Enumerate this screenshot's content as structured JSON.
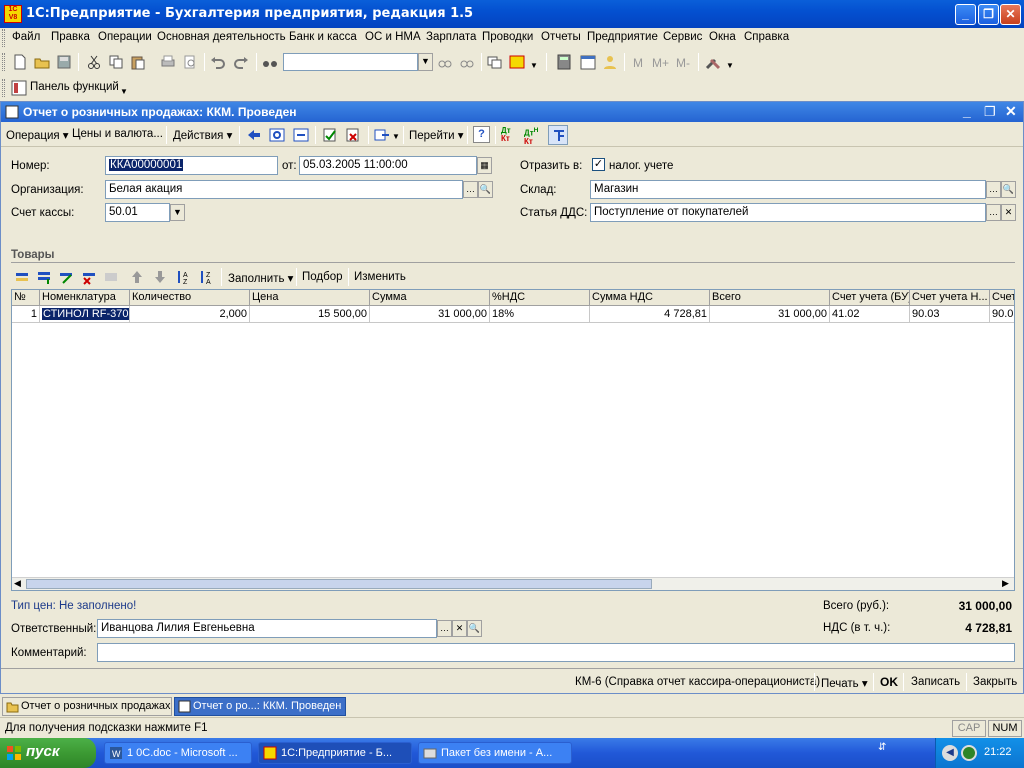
{
  "app": {
    "title": "1С:Предприятие - Бухгалтерия предприятия, редакция 1.5",
    "icon_text": "1C\nV8"
  },
  "menu": [
    "Файл",
    "Правка",
    "Операции",
    "Основная деятельность",
    "Банк и касса",
    "ОС и НМА",
    "Зарплата",
    "Проводки",
    "Отчеты",
    "Предприятие",
    "Сервис",
    "Окна",
    "Справка"
  ],
  "toolbar2": {
    "panel_label": "Панель функций",
    "mark_m": "M",
    "mark_mplus": "M+",
    "mark_mminus": "M-"
  },
  "doc": {
    "title": "Отчет о розничных продажах: ККМ. Проведен",
    "toolbar": {
      "operation": "Операция",
      "prices": "Цены и валюта...",
      "actions": "Действия",
      "goto": "Перейти",
      "help": "?"
    },
    "fields": {
      "number_label": "Номер:",
      "number_value": "ККА00000001",
      "from_label": "от:",
      "from_value": "05.03.2005 11:00:00",
      "org_label": "Организация:",
      "org_value": "Белая акация",
      "cash_label": "Счет кассы:",
      "cash_value": "50.01",
      "reflect_label": "Отразить в:",
      "reflect_check": "налог. учете",
      "warehouse_label": "Склад:",
      "warehouse_value": "Магазин",
      "dds_label": "Статья ДДС:",
      "dds_value": "Поступление от покупателей"
    },
    "goods": {
      "section_label": "Товары",
      "fill_label": "Заполнить",
      "pick_label": "Подбор",
      "change_label": "Изменить",
      "columns": [
        "№",
        "Номенклатура",
        "Количество",
        "Цена",
        "Сумма",
        "%НДС",
        "Сумма НДС",
        "Всего",
        "Счет учета (БУ)",
        "Счет учета Н...",
        "Счет"
      ],
      "rows": [
        [
          "1",
          "СТИНОЛ RF-370",
          "2,000",
          "15 500,00",
          "31 000,00",
          "18%",
          "4 728,81",
          "31 000,00",
          "41.02",
          "90.03",
          "90.0"
        ]
      ]
    },
    "price_type": "Тип цен: Не заполнено!",
    "total_label": "Всего (руб.):",
    "total_value": "31 000,00",
    "vat_label": "НДС (в т. ч.):",
    "vat_value": "4 728,81",
    "responsible_label": "Ответственный:",
    "responsible_value": "Иванцова Лилия Евгеньевна",
    "comment_label": "Комментарий:",
    "comment_value": "",
    "footer": {
      "km6": "КМ-6 (Справка отчет кассира-операциониста)",
      "print": "Печать",
      "ok": "OK",
      "save": "Записать",
      "close": "Закрыть"
    }
  },
  "window_tabs": [
    "Отчет о розничных продажах",
    "Отчет о ро...: ККМ. Проведен"
  ],
  "status": {
    "hint": "Для получения подсказки нажмите F1",
    "cap": "CAP",
    "num": "NUM"
  },
  "taskbar": {
    "start": "пуск",
    "tasks": [
      "1 0С.doc - Microsoft ...",
      "1С:Предприятие - Б...",
      "Пакет без имени - А..."
    ],
    "clock": "21:22"
  },
  "colors": {
    "xp_blue": "#0450D0",
    "selection": "#0A246A",
    "taskbar": "#2158D8",
    "start_green": "#3C9A33"
  }
}
